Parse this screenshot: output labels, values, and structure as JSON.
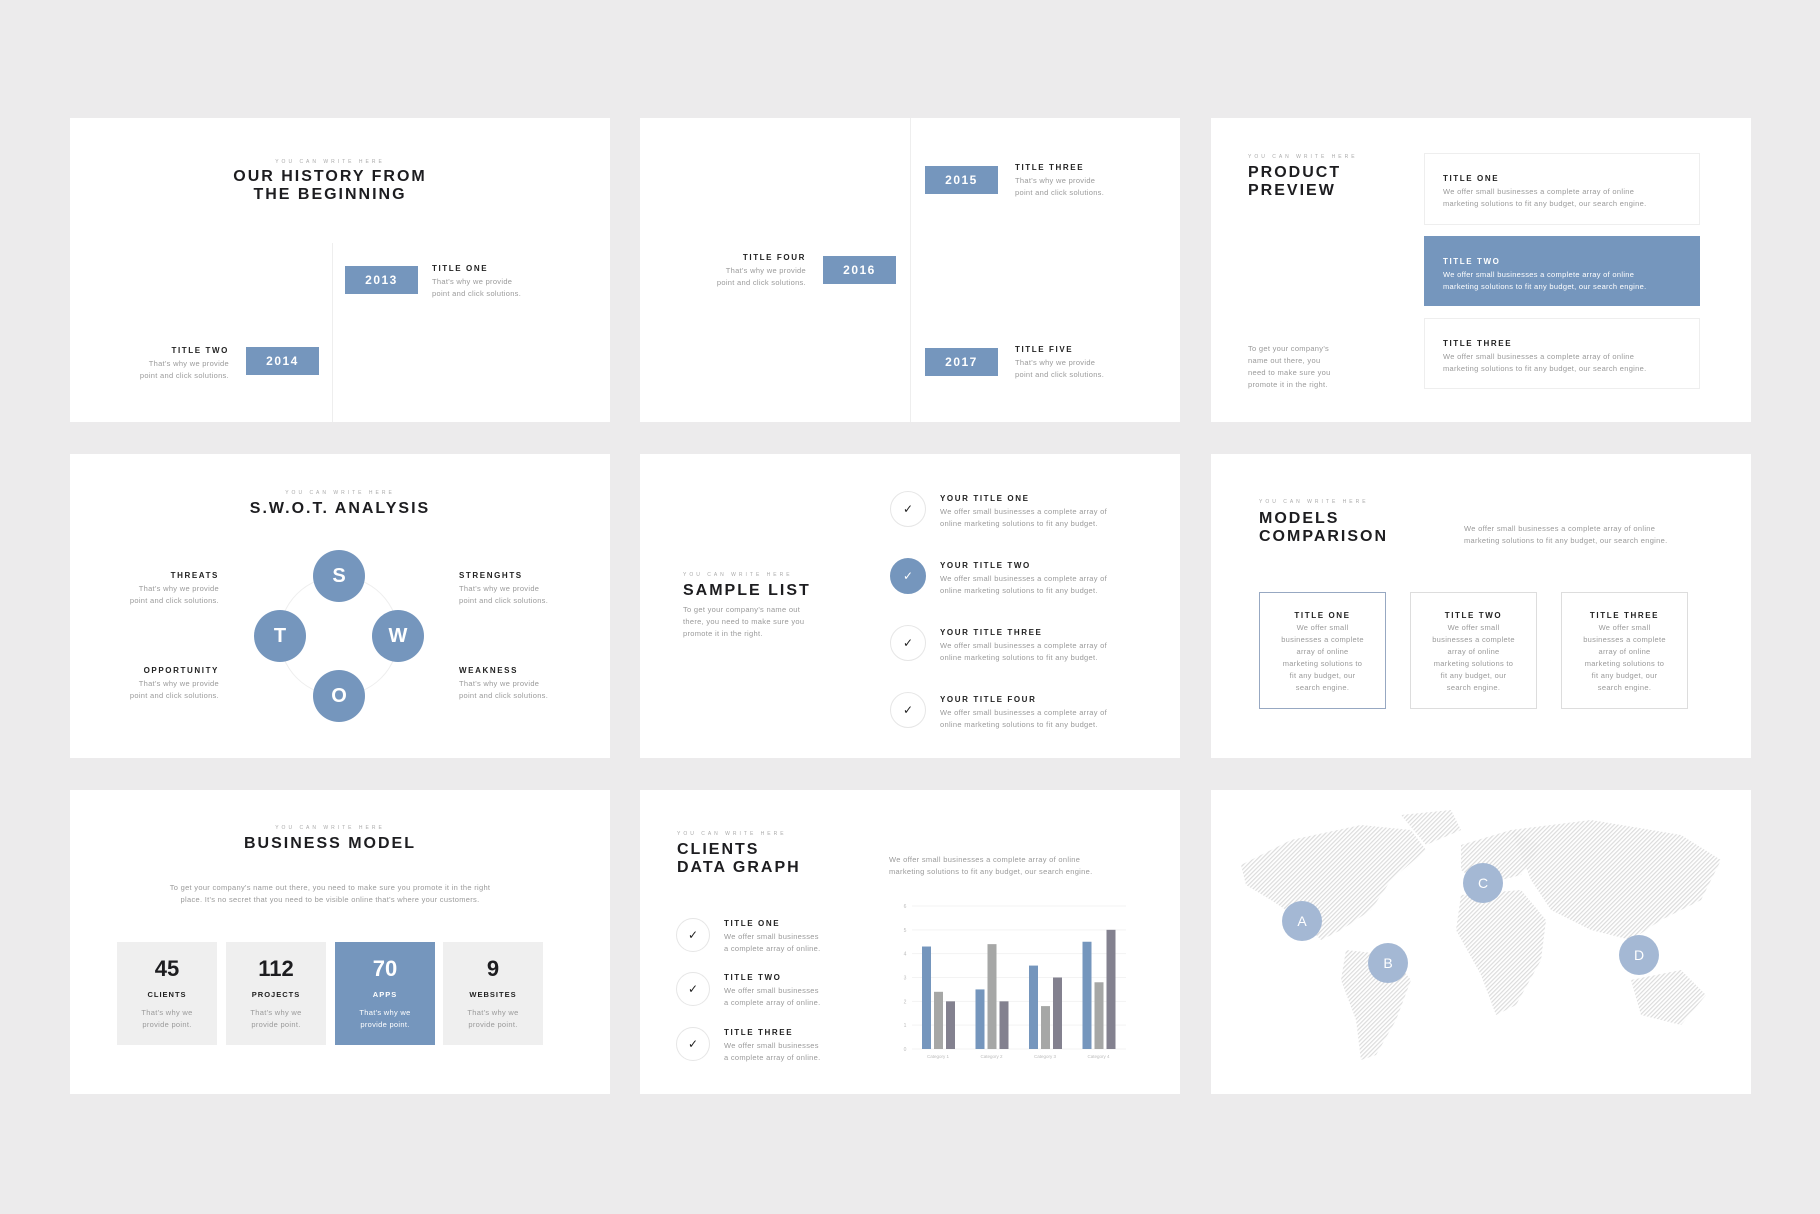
{
  "accent": "#7596bd",
  "background": "#ecebec",
  "kicker": "YOU CAN WRITE HERE",
  "history": {
    "title": "OUR HISTORY FROM\nTHE BEGINNING",
    "items": [
      {
        "year": "2013",
        "title": "TITLE ONE",
        "desc": "That's why we provide\npoint and click solutions."
      },
      {
        "year": "2014",
        "title": "TITLE TWO",
        "desc": "That's why we provide\npoint and click solutions."
      }
    ]
  },
  "timeline": {
    "items": [
      {
        "year": "2015",
        "title": "TITLE THREE",
        "desc": "That's why we provide\npoint and click solutions."
      },
      {
        "year": "2016",
        "title": "TITLE FOUR",
        "desc": "That's why we provide\npoint and click solutions."
      },
      {
        "year": "2017",
        "title": "TITLE FIVE",
        "desc": "That's why we provide\npoint and click solutions."
      }
    ]
  },
  "product": {
    "title": "PRODUCT\nPREVIEW",
    "desc": "To get your company's\nname out there, you\nneed to make sure you\npromote it in the right.",
    "cards": [
      {
        "title": "TITLE ONE",
        "desc": "We offer small businesses a complete array of online\nmarketing solutions to fit any budget, our search engine."
      },
      {
        "title": "TITLE TWO",
        "desc": "We offer small businesses a complete array of online\nmarketing solutions to fit any budget, our search engine."
      },
      {
        "title": "TITLE THREE",
        "desc": "We offer small businesses a complete array of online\nmarketing solutions to fit any budget, our search engine."
      }
    ]
  },
  "swot": {
    "title": "S.W.O.T. ANALYSIS",
    "letters": [
      "S",
      "T",
      "W",
      "O"
    ],
    "items": [
      {
        "title": "THREATS",
        "desc": "That's why we provide\npoint and click solutions."
      },
      {
        "title": "STRENGHTS",
        "desc": "That's why we provide\npoint and click solutions."
      },
      {
        "title": "OPPORTUNITY",
        "desc": "That's why we provide\npoint and click solutions."
      },
      {
        "title": "WEAKNESS",
        "desc": "That's why we provide\npoint and click solutions."
      }
    ]
  },
  "sample": {
    "title": "SAMPLE LIST",
    "desc": "To get your company's name out\nthere, you need to make sure you\npromote it in the right.",
    "items": [
      {
        "title": "YOUR TITLE ONE",
        "desc": "We offer small businesses a complete array of\nonline marketing solutions to fit any budget."
      },
      {
        "title": "YOUR TITLE TWO",
        "desc": "We offer small businesses a complete array of\nonline marketing solutions to fit any budget."
      },
      {
        "title": "YOUR TITLE THREE",
        "desc": "We offer small businesses a complete array of\nonline marketing solutions to fit any budget."
      },
      {
        "title": "YOUR TITLE FOUR",
        "desc": "We offer small businesses a complete array of\nonline marketing solutions to fit any budget."
      }
    ]
  },
  "models": {
    "title": "MODELS\nCOMPARISON",
    "desc": "We offer small businesses a complete array of online\nmarketing solutions to fit any budget, our search engine.",
    "boxes": [
      {
        "title": "TITLE ONE",
        "desc": "We offer small\nbusinesses a complete\narray of online\nmarketing solutions to\nfit any budget, our\nsearch engine."
      },
      {
        "title": "TITLE TWO",
        "desc": "We offer small\nbusinesses a complete\narray of online\nmarketing solutions to\nfit any budget, our\nsearch engine."
      },
      {
        "title": "TITLE THREE",
        "desc": "We offer small\nbusinesses a complete\narray of online\nmarketing solutions to\nfit any budget, our\nsearch engine."
      }
    ]
  },
  "business": {
    "title": "BUSINESS MODEL",
    "desc": "To get your company's name out there, you need to make sure you promote it in the right\nplace. It's no secret that you need to be visible online that's where your customers.",
    "stats": [
      {
        "value": "45",
        "label": "CLIENTS",
        "desc": "That's why we\nprovide point."
      },
      {
        "value": "112",
        "label": "PROJECTS",
        "desc": "That's why we\nprovide point."
      },
      {
        "value": "70",
        "label": "APPS",
        "desc": "That's why we\nprovide point."
      },
      {
        "value": "9",
        "label": "WEBSITES",
        "desc": "That's why we\nprovide point."
      }
    ]
  },
  "clients": {
    "title": "CLIENTS\nDATA GRAPH",
    "desc": "We offer small businesses a complete array of online\nmarketing solutions to fit any budget, our search engine.",
    "items": [
      {
        "title": "TITLE ONE",
        "desc": "We offer small businesses\na complete array of online."
      },
      {
        "title": "TITLE TWO",
        "desc": "We offer small businesses\na complete array of online."
      },
      {
        "title": "TITLE THREE",
        "desc": "We offer small businesses\na complete array of online."
      }
    ]
  },
  "chart_data": {
    "type": "bar",
    "categories": [
      "Category 1",
      "Category 2",
      "Category 3",
      "Category 4"
    ],
    "series": [
      {
        "values": [
          4.3,
          2.5,
          3.5,
          4.5
        ],
        "color": "#7596bd"
      },
      {
        "values": [
          2.4,
          4.4,
          1.8,
          2.8
        ],
        "color": "#a6a7a6"
      },
      {
        "values": [
          2.0,
          2.0,
          3.0,
          5.0
        ],
        "color": "#83818f"
      }
    ],
    "ylim": [
      0,
      6
    ],
    "yticks": [
      "0",
      "1",
      "2",
      "3",
      "4",
      "5",
      "6"
    ],
    "grid": true
  },
  "map": {
    "pins": [
      "A",
      "B",
      "C",
      "D"
    ],
    "pin_color": "#a4b8d4"
  }
}
